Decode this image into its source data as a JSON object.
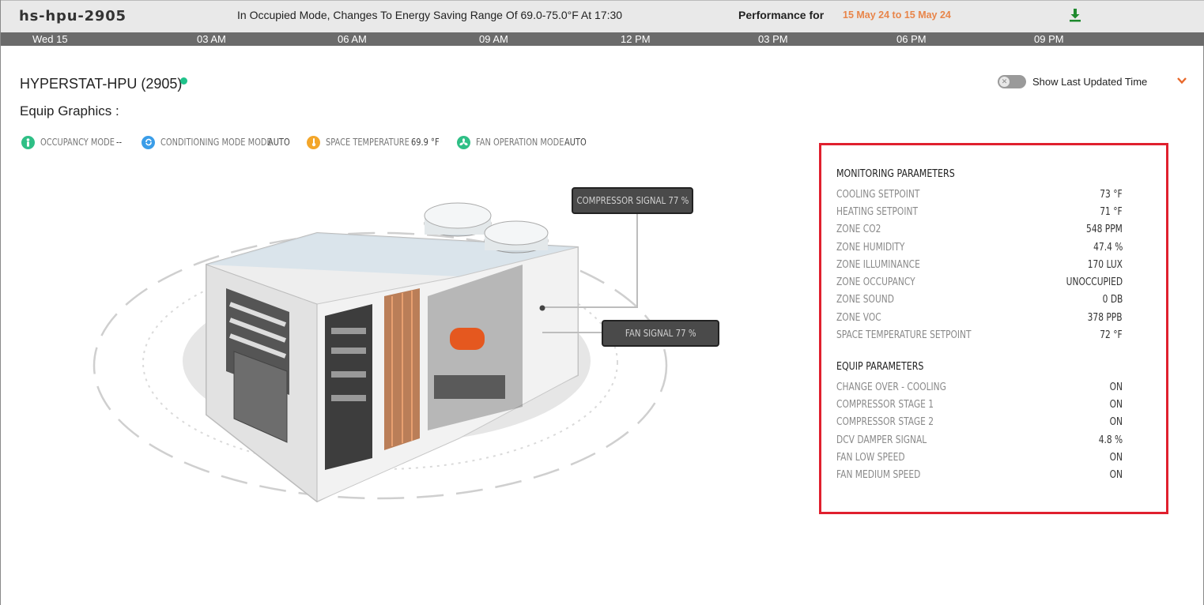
{
  "header": {
    "device_name": "hs-hpu-2905",
    "schedule_message": "In Occupied Mode, Changes To Energy Saving Range Of 69.0-75.0°F At 17:30",
    "performance_label": "Performance for",
    "performance_range": "15 May 24 to 15 May 24",
    "download_icon": "download-icon",
    "accent_color": "#e8854a"
  },
  "timeline": {
    "ticks": [
      "Wed 15",
      "03 AM",
      "06 AM",
      "09 AM",
      "12 PM",
      "03 PM",
      "06 PM",
      "09 PM"
    ]
  },
  "equip": {
    "name": "HYPERSTAT-HPU (2905)",
    "status_color": "#1fc28a",
    "graphics_label": "Equip Graphics :",
    "show_last_updated_label": "Show Last Updated Time",
    "toggle_on": false
  },
  "status_points": [
    {
      "label": "OCCUPANCY MODE",
      "value": "--",
      "icon": "person-icon",
      "color": "#2fbf86"
    },
    {
      "label": "CONDITIONING MODE MODE",
      "value": "AUTO",
      "icon": "cycle-icon",
      "color": "#3a9de8"
    },
    {
      "label": "SPACE TEMPERATURE",
      "value": "69.9 °F",
      "icon": "thermometer-icon",
      "color": "#f3a62a"
    },
    {
      "label": "FAN OPERATION MODE",
      "value": "AUTO",
      "icon": "fan-icon",
      "color": "#2fbf86"
    }
  ],
  "callouts": {
    "compressor": "COMPRESSOR SIGNAL 77 %",
    "fan": "FAN SIGNAL 77 %"
  },
  "monitoring": {
    "title": "MONITORING PARAMETERS",
    "rows": [
      {
        "name": "COOLING SETPOINT",
        "value": "73 °F"
      },
      {
        "name": "HEATING SETPOINT",
        "value": "71 °F"
      },
      {
        "name": "ZONE CO2",
        "value": "548 PPM"
      },
      {
        "name": "ZONE HUMIDITY",
        "value": "47.4 %"
      },
      {
        "name": "ZONE ILLUMINANCE",
        "value": "170 LUX"
      },
      {
        "name": "ZONE OCCUPANCY",
        "value": "UNOCCUPIED"
      },
      {
        "name": "ZONE SOUND",
        "value": "0 DB"
      },
      {
        "name": "ZONE VOC",
        "value": "378 PPB"
      },
      {
        "name": "SPACE TEMPERATURE SETPOINT",
        "value": "72 °F"
      }
    ]
  },
  "equip_params": {
    "title": "EQUIP PARAMETERS",
    "rows": [
      {
        "name": "CHANGE OVER - COOLING",
        "value": "ON"
      },
      {
        "name": "COMPRESSOR STAGE 1",
        "value": "ON"
      },
      {
        "name": "COMPRESSOR STAGE 2",
        "value": "ON"
      },
      {
        "name": "DCV DAMPER SIGNAL",
        "value": "4.8 %"
      },
      {
        "name": "FAN LOW SPEED",
        "value": "ON"
      },
      {
        "name": "FAN MEDIUM SPEED",
        "value": "ON"
      }
    ]
  },
  "highlight_color": "#e0202e"
}
